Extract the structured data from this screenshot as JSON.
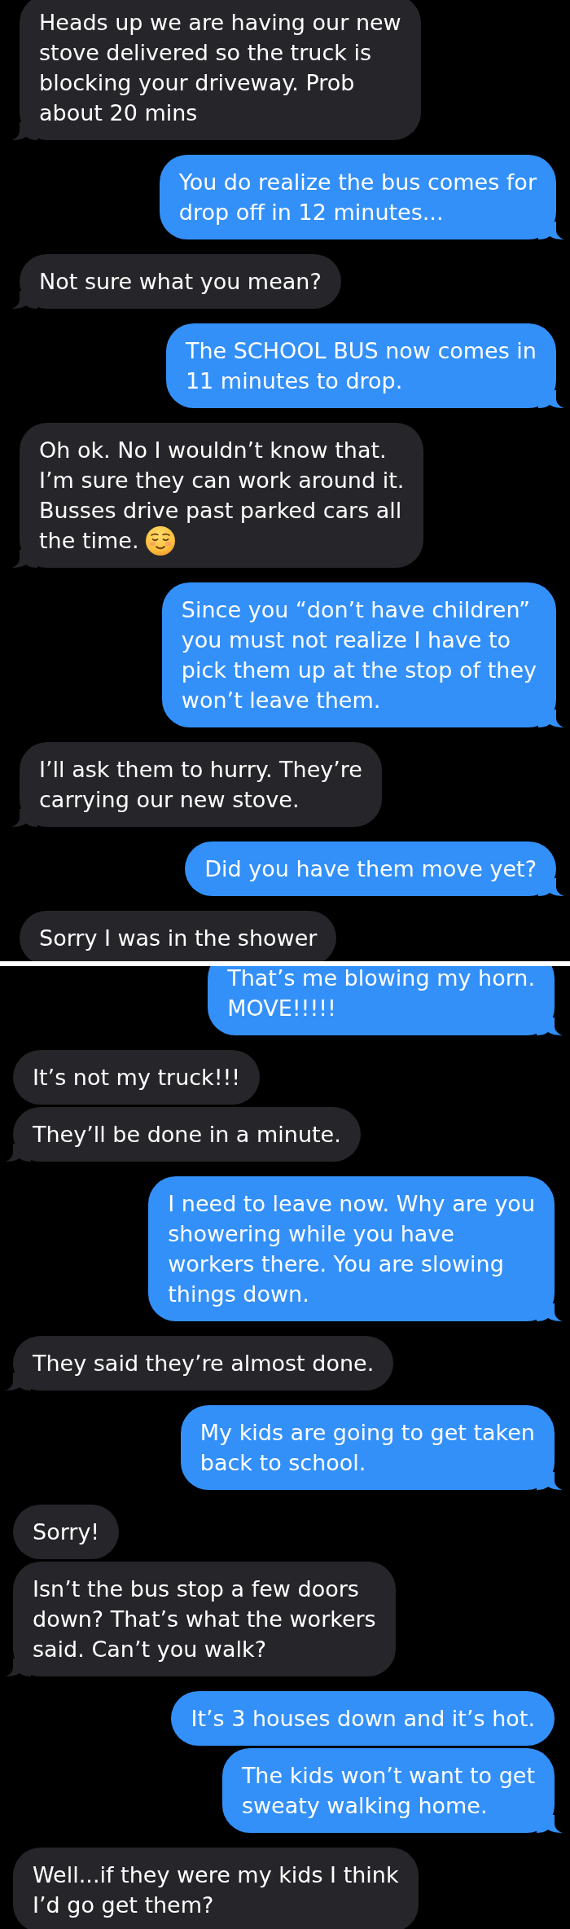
{
  "screenshots": [
    {
      "messages": [
        {
          "kind": "received",
          "tail": true,
          "lines": [
            "Heads up we are having our new",
            "stove delivered so the truck is",
            "blocking your driveway. Prob",
            "about 20 mins"
          ]
        },
        {
          "kind": "sent",
          "tail": true,
          "lines": [
            "You do realize the bus comes for",
            "drop off in 12 minutes..."
          ]
        },
        {
          "kind": "received",
          "tail": true,
          "lines": [
            "Not sure what you mean?"
          ]
        },
        {
          "kind": "sent",
          "tail": true,
          "lines": [
            "The SCHOOL BUS now comes in",
            "11 minutes to drop."
          ]
        },
        {
          "kind": "received",
          "tail": true,
          "trailing_emoji": true,
          "lines": [
            "Oh ok. No I wouldn’t know that.",
            "I’m sure they can work around it.",
            "Busses drive past parked cars all",
            "the time."
          ]
        },
        {
          "kind": "sent",
          "tail": true,
          "lines": [
            "Since you “don’t have children”",
            "you must not realize I have to",
            "pick them up at the stop of they",
            "won’t leave them."
          ]
        },
        {
          "kind": "received",
          "tail": true,
          "lines": [
            "I’ll ask them to hurry. They’re",
            "carrying our new stove."
          ]
        },
        {
          "kind": "sent",
          "tail": true,
          "lines": [
            "Did you have them move yet?"
          ]
        },
        {
          "kind": "received",
          "tail": false,
          "lines": [
            "Sorry I was in the shower"
          ]
        }
      ]
    },
    {
      "messages": [
        {
          "kind": "sent",
          "tail": true,
          "lines": [
            "That’s me blowing my horn.",
            "MOVE!!!!!"
          ]
        },
        {
          "kind": "received",
          "tail": false,
          "lines": [
            "It’s not my truck!!!"
          ]
        },
        {
          "kind": "received",
          "tail": true,
          "lines": [
            "They’ll be done in a minute."
          ]
        },
        {
          "kind": "sent",
          "tail": true,
          "lines": [
            "I need to leave now. Why are you",
            "showering while you have",
            "workers there. You are slowing",
            "things down."
          ]
        },
        {
          "kind": "received",
          "tail": true,
          "lines": [
            "They said they’re almost done."
          ]
        },
        {
          "kind": "sent",
          "tail": true,
          "lines": [
            "My kids are going to get taken",
            "back to school."
          ]
        },
        {
          "kind": "received",
          "tail": false,
          "lines": [
            "Sorry!"
          ]
        },
        {
          "kind": "received",
          "tail": true,
          "lines": [
            "Isn’t the bus stop a few doors",
            "down? That’s what the workers",
            "said. Can’t you walk?"
          ]
        },
        {
          "kind": "sent",
          "tail": false,
          "lines": [
            "It’s 3 houses down and it’s hot."
          ]
        },
        {
          "kind": "sent",
          "tail": true,
          "lines": [
            "The kids won’t want to get",
            "sweaty walking home."
          ]
        },
        {
          "kind": "received",
          "tail": false,
          "lines": [
            "Well...if they were my kids I think",
            "I’d go get them?"
          ]
        }
      ]
    }
  ]
}
